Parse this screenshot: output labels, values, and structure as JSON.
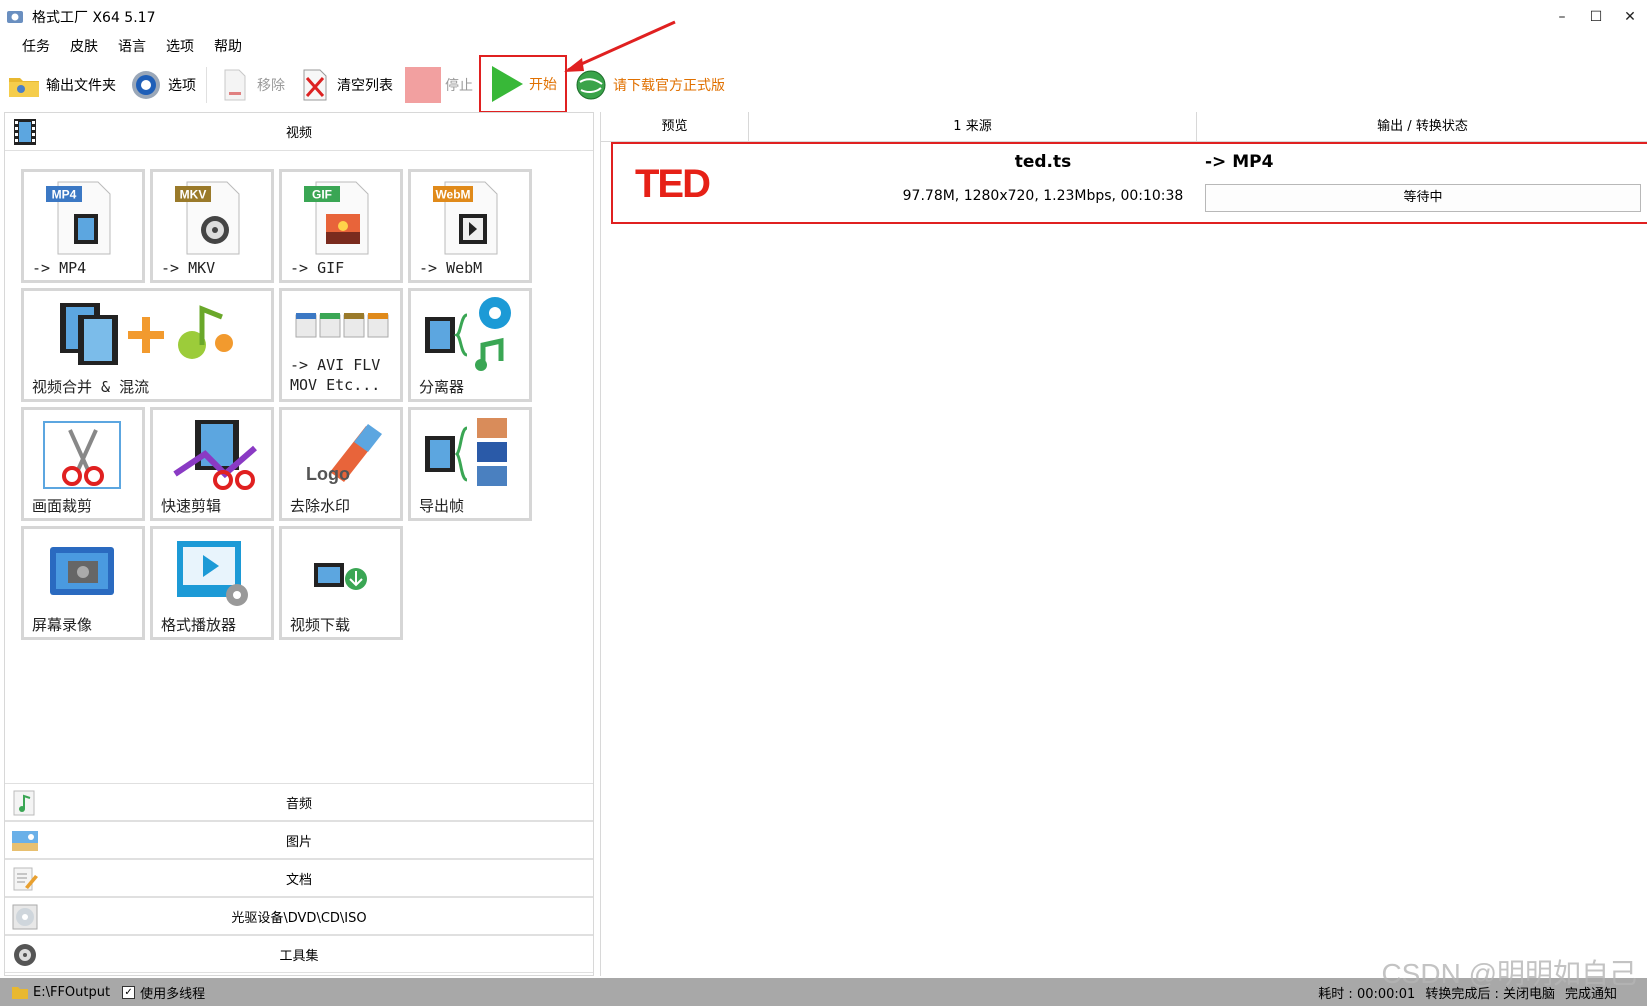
{
  "window": {
    "title": "格式工厂 X64 5.17",
    "controls": {
      "minimize": "–",
      "maximize": "☐",
      "close": "✕"
    }
  },
  "menu": [
    "任务",
    "皮肤",
    "语言",
    "选项",
    "帮助"
  ],
  "toolbar": {
    "output_folder": "输出文件夹",
    "options": "选项",
    "remove": "移除",
    "clear_list": "清空列表",
    "stop": "停止",
    "start": "开始",
    "promo": "请下载官方正式版"
  },
  "left": {
    "video_category": "视频",
    "tiles": [
      {
        "label": "-> MP4",
        "badge": "MP4",
        "badge_color": "#3b78c4"
      },
      {
        "label": "-> MKV",
        "badge": "MKV",
        "badge_color": "#9a7a2a"
      },
      {
        "label": "-> GIF",
        "badge": "GIF",
        "badge_color": "#3aa654"
      },
      {
        "label": "-> WebM",
        "badge": "WebM",
        "badge_color": "#e08a1a"
      },
      {
        "label": "视频合并 & 混流"
      },
      {
        "label": "-> AVI FLV\nMOV Etc..."
      },
      {
        "label": "分离器"
      },
      {
        "label": "画面裁剪"
      },
      {
        "label": "快速剪辑"
      },
      {
        "label": "去除水印",
        "logo_text": "Logo"
      },
      {
        "label": "导出帧"
      },
      {
        "label": "屏幕录像"
      },
      {
        "label": "格式播放器"
      },
      {
        "label": "视频下载"
      }
    ],
    "bottom_categories": [
      "音频",
      "图片",
      "文档",
      "光驱设备\\DVD\\CD\\ISO",
      "工具集"
    ]
  },
  "right": {
    "columns": {
      "preview": "预览",
      "source": "1 来源",
      "output": "输出 / 转换状态"
    },
    "task": {
      "logo": "TED",
      "file_name": "ted.ts",
      "file_info": "97.78M, 1280x720, 1.23Mbps, 00:10:38",
      "output_format": "-> MP4",
      "status": "等待中"
    }
  },
  "statusbar": {
    "output_path": "E:\\FFOutput",
    "multithread_label": "使用多线程",
    "multithread_checked": "✓",
    "elapsed": "耗时 : 00:00:01",
    "after_convert": "转换完成后 : 关闭电脑",
    "notify": "完成通知",
    "watermark": "CSDN @明明如自己"
  }
}
